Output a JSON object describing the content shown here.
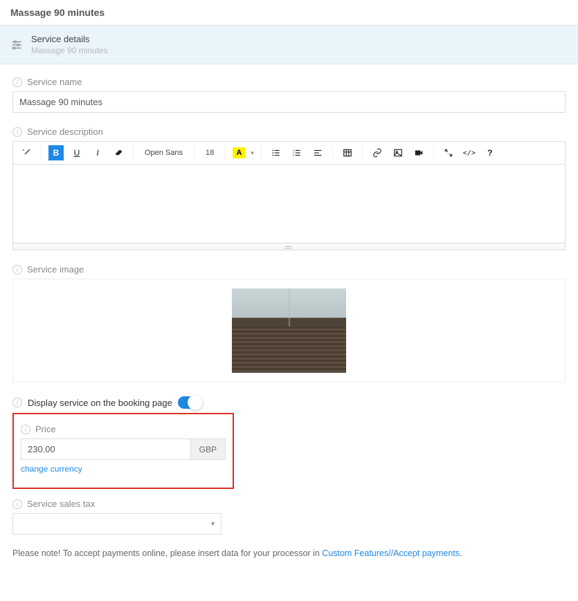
{
  "page_title": "Massage 90 minutes",
  "section_header": {
    "title": "Service details",
    "subtitle": "Massage 90 minutes"
  },
  "labels": {
    "service_name": "Service name",
    "service_description": "Service description",
    "service_image": "Service image",
    "display_on_booking": "Display service on the booking page",
    "price": "Price",
    "change_currency": "change currency",
    "sales_tax": "Service sales tax"
  },
  "fields": {
    "service_name_value": "Massage 90 minutes",
    "price_value": "230.00",
    "price_currency": "GBP",
    "display_on_booking": true,
    "sales_tax_value": ""
  },
  "editor_toolbar": {
    "font_family": "Open Sans",
    "font_size": "18",
    "color_swatch_letter": "A"
  },
  "note": {
    "prefix": "Please note! To accept payments online, please insert data for your processor in ",
    "link_text": "Custom Features//Accept payments",
    "suffix": "."
  }
}
